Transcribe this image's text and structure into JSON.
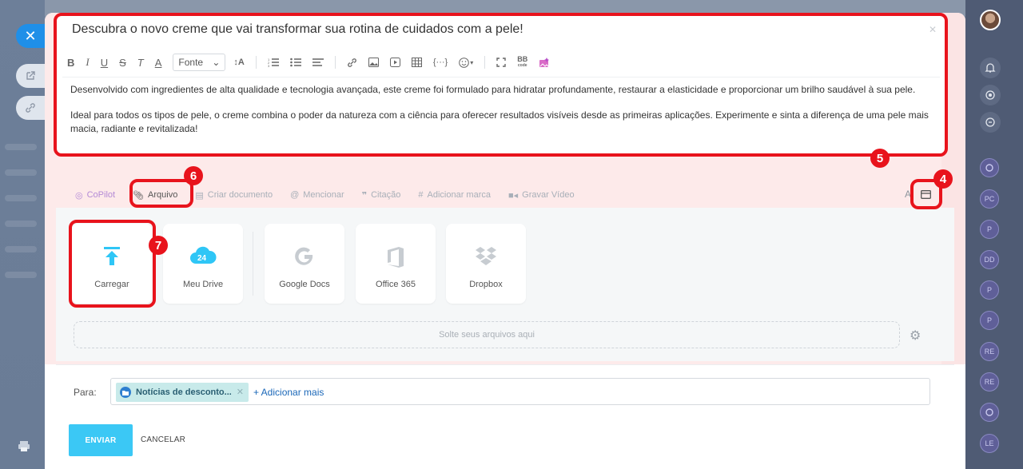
{
  "subject": "Descubra o novo creme que vai transformar sua rotina de cuidados com a pele!",
  "toolbar": {
    "bold": "B",
    "italic": "I",
    "underline": "U",
    "strike": "S",
    "clear_format": "T",
    "color": "A",
    "font_select": "Fonte",
    "font_size": "↕A",
    "bbcode": "BB"
  },
  "body": {
    "paragraph1": "Desenvolvido com ingredientes de alta qualidade e tecnologia avançada, este creme foi formulado para hidratar profundamente, restaurar a elasticidade e proporcionar um brilho saudável à sua pele.",
    "paragraph2": "Ideal para todos os tipos de pele, o creme combina o poder da natureza com a ciência para oferecer resultados visíveis desde as primeiras aplicações. Experimente e sinta a diferença de uma pele mais macia, radiante e revitalizada!"
  },
  "panel_tabs": [
    {
      "label": "CoPilot",
      "icon": "copilot-icon"
    },
    {
      "label": "Arquivo",
      "icon": "paperclip-icon"
    },
    {
      "label": "Criar documento",
      "icon": "document-icon"
    },
    {
      "label": "Mencionar",
      "icon": "at-icon"
    },
    {
      "label": "Citação",
      "icon": "quote-icon"
    },
    {
      "label": "Adicionar marca",
      "icon": "hash-icon"
    },
    {
      "label": "Gravar Vídeo",
      "icon": "video-icon"
    }
  ],
  "sources": {
    "upload": "Carregar",
    "drive": "Meu Drive",
    "drive_badge": "24",
    "gdocs": "Google Docs",
    "office": "Office 365",
    "dropbox": "Dropbox"
  },
  "dropzone": "Solte seus arquivos aqui",
  "recipients": {
    "label": "Para:",
    "chip": "Notícias de desconto...",
    "add_more": "+ Adicionar mais"
  },
  "buttons": {
    "send": "ENVIAR",
    "cancel": "CANCELAR"
  },
  "badges": {
    "b4": "4",
    "b5": "5",
    "b6": "6",
    "b7": "7"
  },
  "right_rail": [
    "PC",
    "P",
    "DD",
    "P",
    "P",
    "RE",
    "RE",
    "LE"
  ],
  "colors": {
    "highlight": "#e8131c",
    "send": "#3bc8f5",
    "link": "#1a67b8",
    "chip_bg": "#c8eaea"
  }
}
